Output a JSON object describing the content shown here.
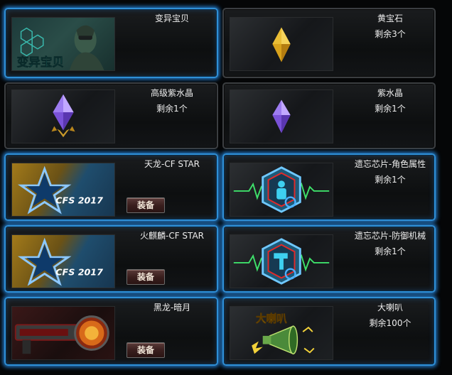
{
  "colors": {
    "selected_border": "#2f8fd6",
    "panel_border": "#3b3e41",
    "equip_button": "#3a1f1e"
  },
  "items": [
    {
      "name": "变异宝贝",
      "count": "",
      "icon": "mutant-baby-icon",
      "thumb_text": "变异宝贝",
      "selected": true,
      "equip": ""
    },
    {
      "name": "黄宝石",
      "count": "剩余3个",
      "icon": "yellow-gem-icon",
      "selected": false,
      "equip": ""
    },
    {
      "name": "高级紫水晶",
      "count": "剩余1个",
      "icon": "purple-crystal-advanced-icon",
      "selected": false,
      "equip": ""
    },
    {
      "name": "紫水晶",
      "count": "剩余1个",
      "icon": "purple-crystal-icon",
      "selected": false,
      "equip": ""
    },
    {
      "name": "天龙-CF STAR",
      "count": "",
      "icon": "cfs-star-icon",
      "thumb_text": "CFS 2017",
      "selected": true,
      "equip": "装备"
    },
    {
      "name": "遗忘芯片-角色属性",
      "count": "剩余1个",
      "icon": "forget-chip-character-icon",
      "selected": true,
      "equip": ""
    },
    {
      "name": "火麒麟-CF STAR",
      "count": "",
      "icon": "cfs-star-icon",
      "thumb_text": "CFS 2017",
      "selected": true,
      "equip": "装备"
    },
    {
      "name": "遗忘芯片-防御机械",
      "count": "剩余1个",
      "icon": "forget-chip-defense-icon",
      "selected": true,
      "equip": ""
    },
    {
      "name": "黑龙-暗月",
      "count": "",
      "icon": "black-dragon-weapon-icon",
      "selected": true,
      "equip": "装备"
    },
    {
      "name": "大喇叭",
      "count": "剩余100个",
      "icon": "megaphone-icon",
      "thumb_text": "大喇叭",
      "selected": true,
      "equip": ""
    }
  ]
}
